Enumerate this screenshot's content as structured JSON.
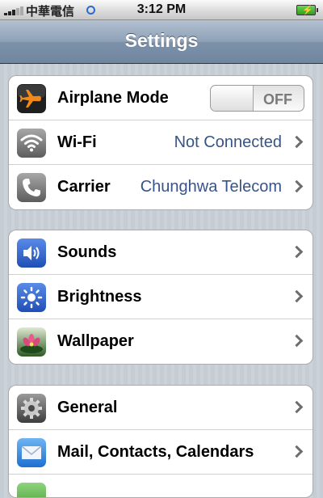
{
  "status_bar": {
    "carrier": "中華電信",
    "time": "3:12 PM"
  },
  "nav": {
    "title": "Settings"
  },
  "group1": {
    "airplane": {
      "label": "Airplane Mode",
      "toggle_text": "OFF"
    },
    "wifi": {
      "label": "Wi-Fi",
      "value": "Not Connected"
    },
    "carrier": {
      "label": "Carrier",
      "value": "Chunghwa Telecom"
    }
  },
  "group2": {
    "sounds": {
      "label": "Sounds"
    },
    "brightness": {
      "label": "Brightness"
    },
    "wallpaper": {
      "label": "Wallpaper"
    }
  },
  "group3": {
    "general": {
      "label": "General"
    },
    "mail": {
      "label": "Mail, Contacts, Calendars"
    }
  },
  "colors": {
    "value_text": "#385487",
    "nav_bar": "#7d92a9",
    "airplane_icon": "#f28a1a",
    "sounds_icon": "#2f5ec8"
  },
  "icons": [
    "airplane-icon",
    "wifi-icon",
    "phone-icon",
    "speaker-icon",
    "sun-icon",
    "flower-icon",
    "gear-icon",
    "envelope-icon"
  ]
}
